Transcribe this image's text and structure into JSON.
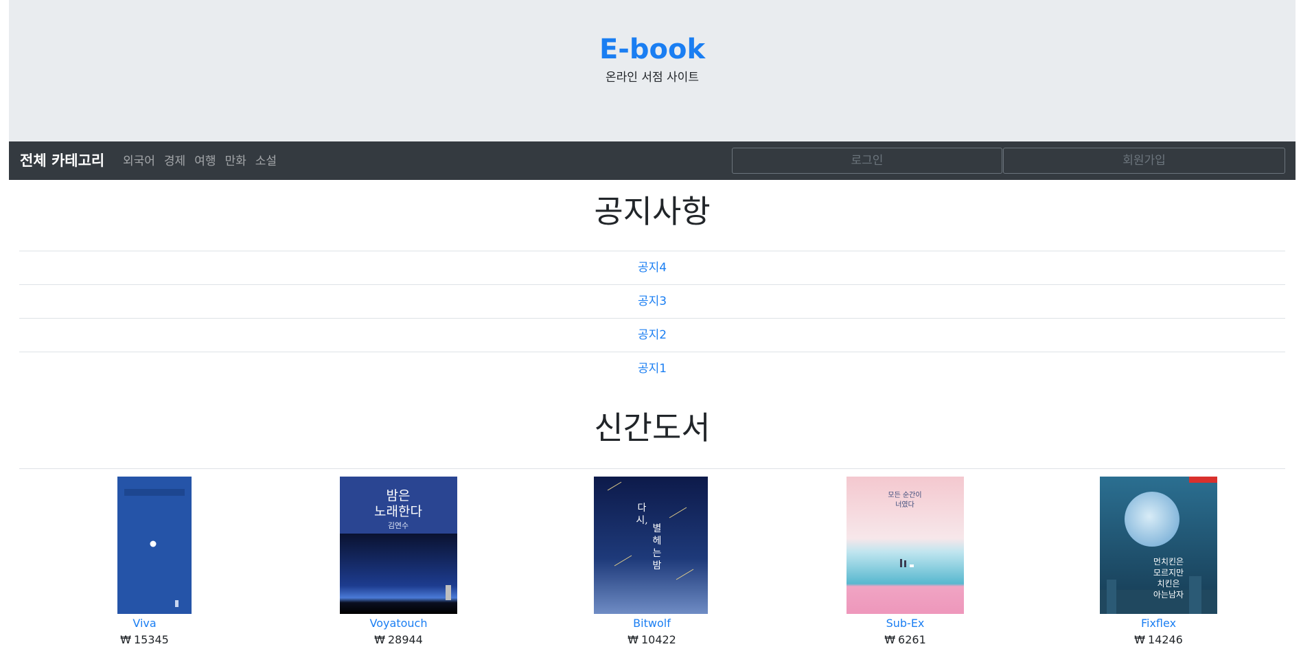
{
  "header": {
    "title": "E-book",
    "subtitle": "온라인 서점 사이트"
  },
  "navbar": {
    "brand": "전체 카테고리",
    "categories": [
      "외국어",
      "경제",
      "여행",
      "만화",
      "소설"
    ],
    "login": "로그인",
    "signup": "회원가입"
  },
  "notices": {
    "title": "공지사항",
    "items": [
      "공지4",
      "공지3",
      "공지2",
      "공지1"
    ]
  },
  "new_books": {
    "title": "신간도서",
    "currency": "₩",
    "items": [
      {
        "name": "Viva",
        "price": "15345"
      },
      {
        "name": "Voyatouch",
        "price": "28944"
      },
      {
        "name": "Bitwolf",
        "price": "10422"
      },
      {
        "name": "Sub-Ex",
        "price": "6261"
      },
      {
        "name": "Fixflex",
        "price": "14246"
      }
    ],
    "cover_text": {
      "book2_title": "밤은 노래한다",
      "book2_author": "김연수",
      "book3_title": "다시, 별 헤는 밤",
      "book4_title": "모든 순간이 너였다",
      "book5_title": "먼치킨은 모르지만 치킨은 아는 남자"
    }
  },
  "colors": {
    "link": "#1a7ef2",
    "navbar": "#343a40",
    "jumbotron": "#e9ecef"
  }
}
